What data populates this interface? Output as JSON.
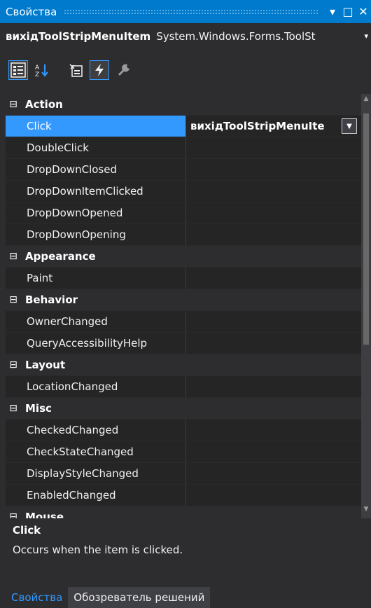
{
  "window": {
    "title": "Свойства",
    "pin_glyph": "▾",
    "maximize_glyph": "□",
    "close_glyph": "✕"
  },
  "object": {
    "name": "вихідToolStripMenuItem",
    "type": "System.Windows.Forms.ToolSt",
    "dropdown_glyph": "▾"
  },
  "toolbar": {
    "icons": [
      "categorized-icon",
      "alphabetical-icon",
      "properties-icon",
      "events-icon",
      "property-pages-icon"
    ],
    "active": "events-icon"
  },
  "categories": [
    {
      "name": "Action",
      "toggle": "⊟",
      "items": [
        {
          "name": "Click",
          "value": "вихідToolStripMenuIte",
          "selected": true
        },
        {
          "name": "DoubleClick",
          "value": ""
        },
        {
          "name": "DropDownClosed",
          "value": ""
        },
        {
          "name": "DropDownItemClicked",
          "value": ""
        },
        {
          "name": "DropDownOpened",
          "value": ""
        },
        {
          "name": "DropDownOpening",
          "value": ""
        }
      ]
    },
    {
      "name": "Appearance",
      "toggle": "⊟",
      "items": [
        {
          "name": "Paint",
          "value": ""
        }
      ]
    },
    {
      "name": "Behavior",
      "toggle": "⊟",
      "items": [
        {
          "name": "OwnerChanged",
          "value": ""
        },
        {
          "name": "QueryAccessibilityHelp",
          "value": ""
        }
      ]
    },
    {
      "name": "Layout",
      "toggle": "⊟",
      "items": [
        {
          "name": "LocationChanged",
          "value": ""
        }
      ]
    },
    {
      "name": "Misc",
      "toggle": "⊟",
      "items": [
        {
          "name": "CheckedChanged",
          "value": ""
        },
        {
          "name": "CheckStateChanged",
          "value": ""
        },
        {
          "name": "DisplayStyleChanged",
          "value": ""
        },
        {
          "name": "EnabledChanged",
          "value": ""
        }
      ]
    },
    {
      "name": "Mouse",
      "toggle": "⊟",
      "items": []
    }
  ],
  "description": {
    "title": "Click",
    "text": "Occurs when the item is clicked."
  },
  "tabs": [
    {
      "label": "Свойства",
      "active": true
    },
    {
      "label": "Обозреватель решений",
      "active": false
    }
  ],
  "colors": {
    "accent": "#007acc",
    "selection": "#3399ff",
    "background": "#2d2d30",
    "grid": "#252526"
  }
}
